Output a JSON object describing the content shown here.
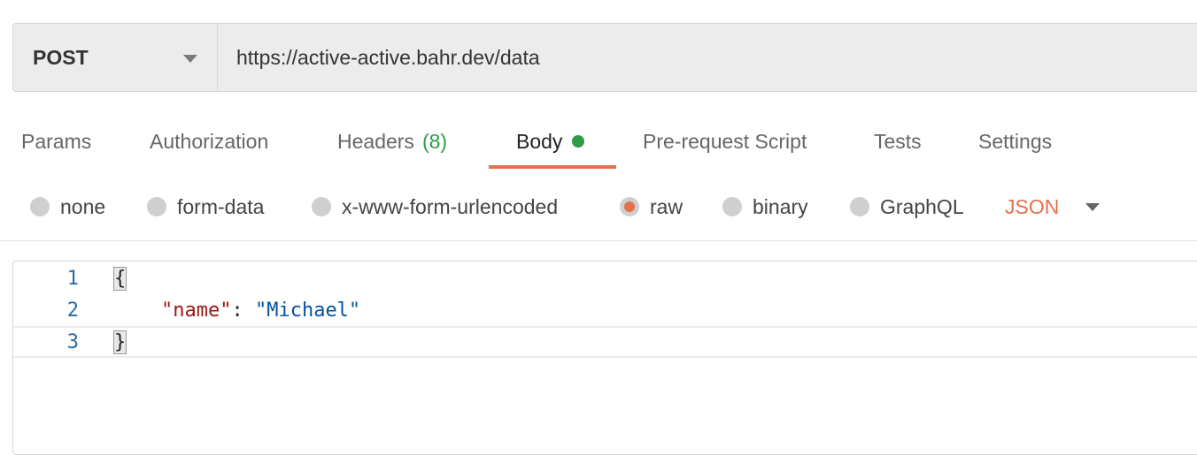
{
  "request": {
    "method": "POST",
    "url": "https://active-active.bahr.dev/data"
  },
  "tabs": [
    {
      "label": "Params"
    },
    {
      "label": "Authorization"
    },
    {
      "label": "Headers",
      "count": "(8)"
    },
    {
      "label": "Body",
      "active": true
    },
    {
      "label": "Pre-request Script"
    },
    {
      "label": "Tests"
    },
    {
      "label": "Settings"
    }
  ],
  "body_types": {
    "options": [
      "none",
      "form-data",
      "x-www-form-urlencoded",
      "raw",
      "binary",
      "GraphQL"
    ],
    "selected": "raw",
    "format": "JSON"
  },
  "editor": {
    "lines": [
      {
        "number": "1",
        "open_brace": "{"
      },
      {
        "number": "2",
        "indent": "    ",
        "key": "\"name\"",
        "colon": ": ",
        "value": "\"Michael\""
      },
      {
        "number": "3",
        "close_brace": "}"
      }
    ]
  },
  "colors": {
    "accent": "#e5704b",
    "status_green": "#2e9b48",
    "json_key": "#a31515",
    "json_string": "#0451a5"
  }
}
